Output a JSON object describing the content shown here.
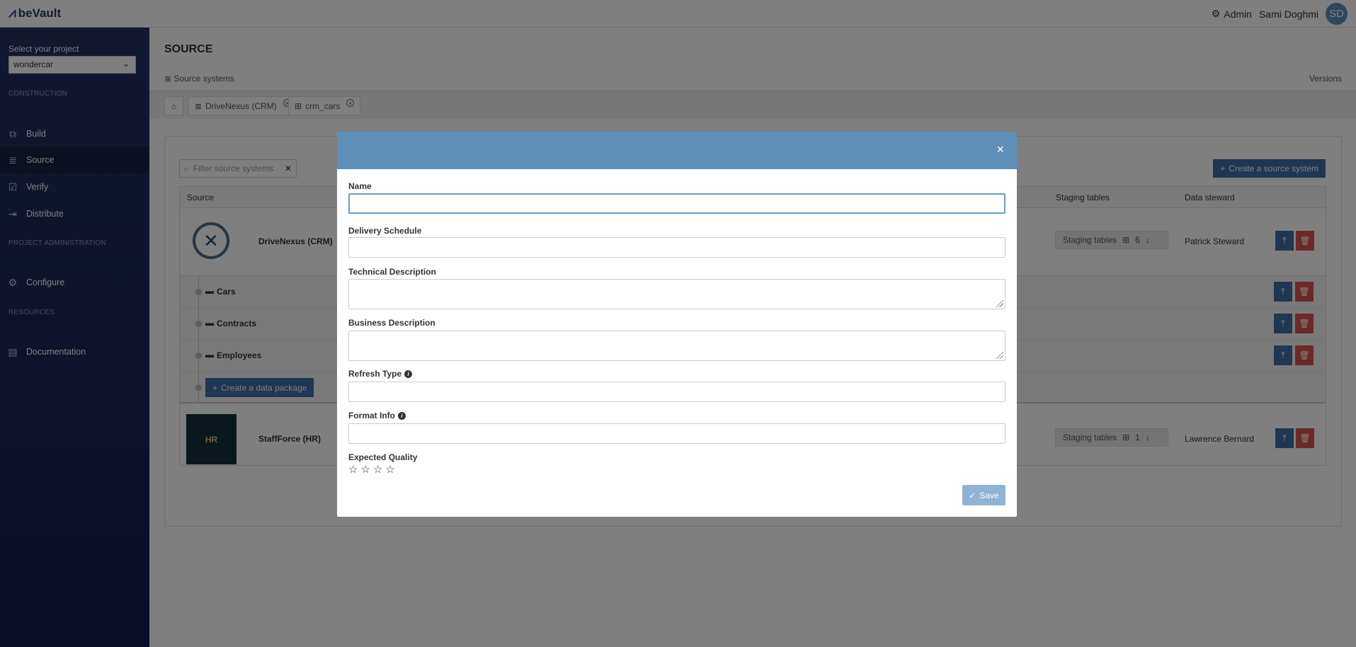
{
  "app": {
    "name": "beVault"
  },
  "header": {
    "admin_label": "Admin",
    "user_name": "Sami Doghmi",
    "user_initials": "SD"
  },
  "sidebar": {
    "project_label": "Select your project",
    "project_value": "wondercar",
    "sections": [
      "CONSTRUCTION",
      "PROJECT ADMINISTRATION",
      "RESOURCES"
    ],
    "items": [
      {
        "label": "Build",
        "icon": "cubes-icon"
      },
      {
        "label": "Source",
        "icon": "database-icon",
        "active": true
      },
      {
        "label": "Verify",
        "icon": "check-square-icon"
      },
      {
        "label": "Distribute",
        "icon": "export-icon"
      },
      {
        "label": "Configure",
        "icon": "gear-icon"
      },
      {
        "label": "Documentation",
        "icon": "book-icon"
      }
    ]
  },
  "page": {
    "title": "SOURCE",
    "breadcrumb": "Source systems",
    "versions": "Versions"
  },
  "tabs": [
    {
      "label": "DriveNexus (CRM)",
      "icon": "database-icon"
    },
    {
      "label": "crm_cars",
      "icon": "table-icon"
    }
  ],
  "toolbar": {
    "filter_placeholder": "Filter source systems",
    "create_label": "Create a source system"
  },
  "table": {
    "headers": {
      "source": "Source",
      "staging": "Staging tables",
      "steward": "Data steward"
    },
    "systems": [
      {
        "name": "DriveNexus (CRM)",
        "staging_label": "Staging tables",
        "staging_count": "6",
        "steward": "Patrick Steward"
      },
      {
        "name": "StaffForce (HR)",
        "staging_label": "Staging tables",
        "staging_count": "1",
        "steward": "Lawrence Bernard",
        "logo_text": "HR"
      }
    ],
    "packages": [
      "Cars",
      "Contracts",
      "Employees"
    ],
    "create_package_label": "Create a data package"
  },
  "modal": {
    "close": "×",
    "fields": {
      "name": "Name",
      "delivery": "Delivery Schedule",
      "technical": "Technical Description",
      "business": "Business Description",
      "refresh": "Refresh Type",
      "format": "Format Info",
      "quality": "Expected Quality"
    },
    "quality_rating": 0,
    "quality_max": 4,
    "save_label": "Save"
  },
  "colors": {
    "sidebar": "#1b2359",
    "modal_header": "#5e8fb8",
    "primary": "#3e6ea6",
    "danger": "#d9534f"
  }
}
